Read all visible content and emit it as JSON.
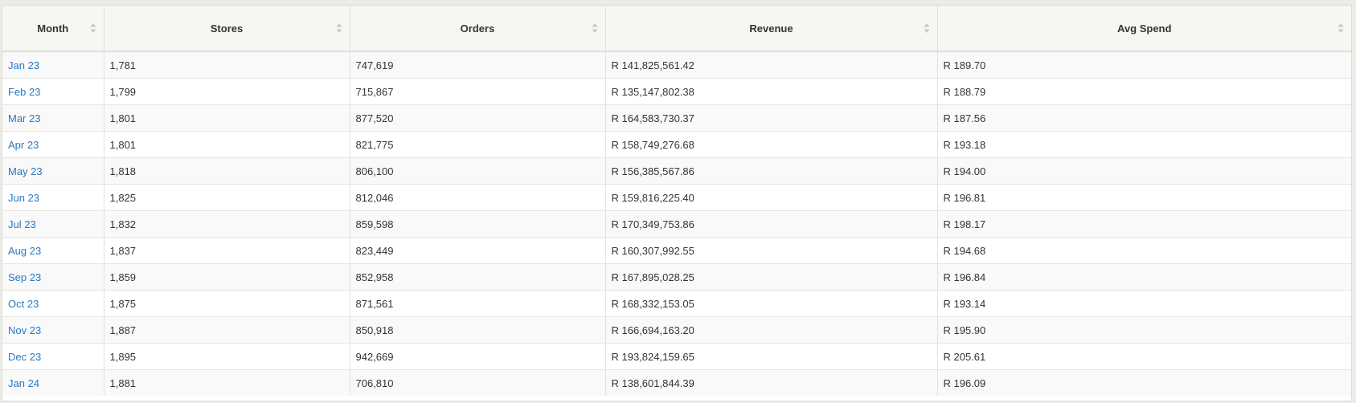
{
  "table": {
    "columns": [
      "Month",
      "Stores",
      "Orders",
      "Revenue",
      "Avg Spend"
    ],
    "rows": [
      [
        "Jan 23",
        "1,781",
        "747,619",
        "R 141,825,561.42",
        "R 189.70"
      ],
      [
        "Feb 23",
        "1,799",
        "715,867",
        "R 135,147,802.38",
        "R 188.79"
      ],
      [
        "Mar 23",
        "1,801",
        "877,520",
        "R 164,583,730.37",
        "R 187.56"
      ],
      [
        "Apr 23",
        "1,801",
        "821,775",
        "R 158,749,276.68",
        "R 193.18"
      ],
      [
        "May 23",
        "1,818",
        "806,100",
        "R 156,385,567.86",
        "R 194.00"
      ],
      [
        "Jun 23",
        "1,825",
        "812,046",
        "R 159,816,225.40",
        "R 196.81"
      ],
      [
        "Jul 23",
        "1,832",
        "859,598",
        "R 170,349,753.86",
        "R 198.17"
      ],
      [
        "Aug 23",
        "1,837",
        "823,449",
        "R 160,307,992.55",
        "R 194.68"
      ],
      [
        "Sep 23",
        "1,859",
        "852,958",
        "R 167,895,028.25",
        "R 196.84"
      ],
      [
        "Oct 23",
        "1,875",
        "871,561",
        "R 168,332,153.05",
        "R 193.14"
      ],
      [
        "Nov 23",
        "1,887",
        "850,918",
        "R 166,694,163.20",
        "R 195.90"
      ],
      [
        "Dec 23",
        "1,895",
        "942,669",
        "R 193,824,159.65",
        "R 205.61"
      ],
      [
        "Jan 24",
        "1,881",
        "706,810",
        "R 138,601,844.39",
        "R 196.09"
      ]
    ]
  },
  "icons": {
    "sort": "sort-both-icon"
  },
  "colors": {
    "link": "#2a78c0",
    "header_bg": "#f7f7f2",
    "row_alt": "#f9f9f9"
  }
}
